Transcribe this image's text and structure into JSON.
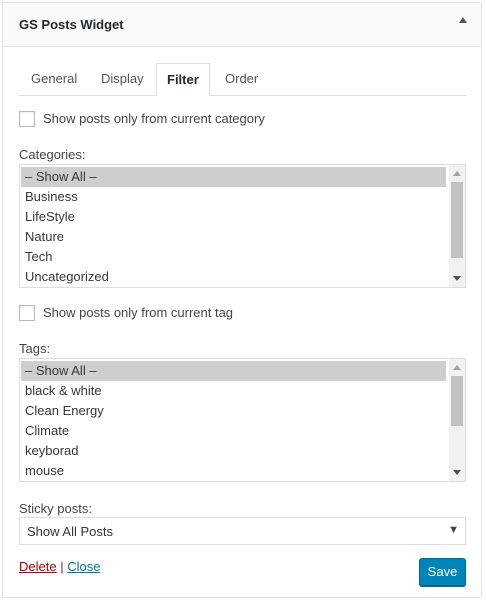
{
  "widget": {
    "title": "GS Posts Widget"
  },
  "tabs": [
    {
      "label": "General"
    },
    {
      "label": "Display"
    },
    {
      "label": "Filter"
    },
    {
      "label": "Order"
    }
  ],
  "active_tab": "Filter",
  "filter": {
    "current_category": {
      "label": "Show posts only from current category",
      "checked": false
    },
    "categories": {
      "label": "Categories:",
      "options": [
        "– Show All –",
        "Business",
        "LifeStyle",
        "Nature",
        "Tech",
        "Uncategorized"
      ],
      "selected": "– Show All –"
    },
    "current_tag": {
      "label": "Show posts only from current tag",
      "checked": false
    },
    "tags": {
      "label": "Tags:",
      "options": [
        "– Show All –",
        "black & white",
        "Clean Energy",
        "Climate",
        "keyborad",
        "mouse"
      ],
      "selected": "– Show All –"
    },
    "sticky": {
      "label": "Sticky posts:",
      "value": "Show All Posts"
    }
  },
  "actions": {
    "delete_label": "Delete",
    "separator": "|",
    "close_label": "Close",
    "save_label": "Save"
  },
  "colors": {
    "save_button": "#0085ba",
    "delete_link": "#aa0000",
    "close_link": "#0073aa",
    "selected_option": "#cecece"
  }
}
